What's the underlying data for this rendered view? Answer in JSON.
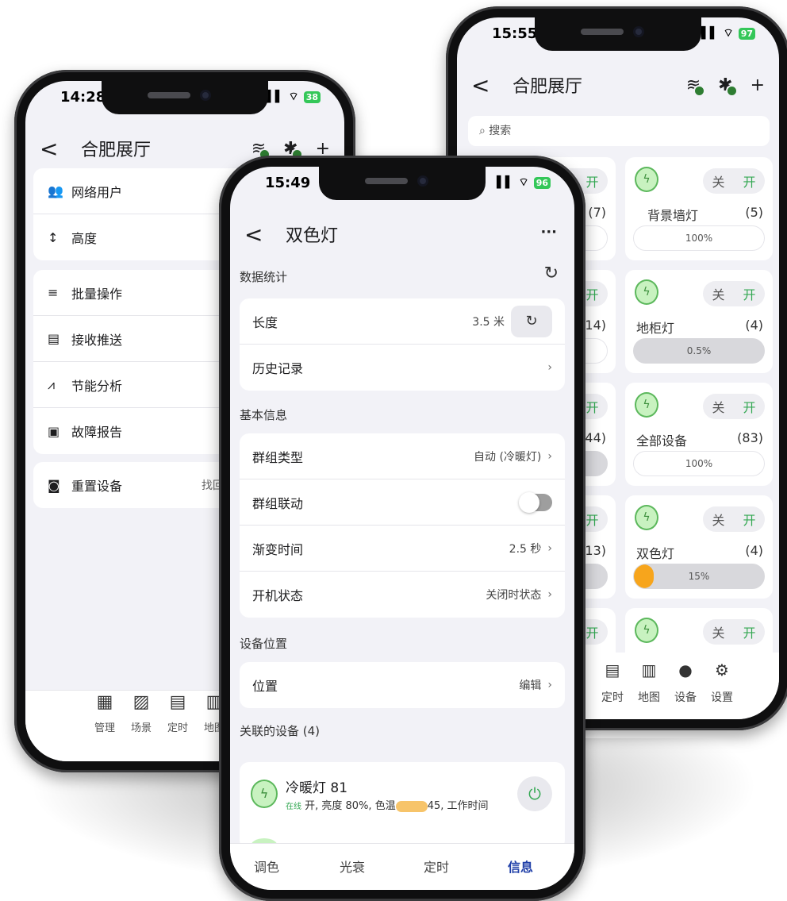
{
  "phoneA": {
    "status": {
      "time": "14:28",
      "battery": "38"
    },
    "nav": {
      "back": "<",
      "title": "合肥展厅",
      "add": "+"
    },
    "group1": [
      {
        "icon": "users-icon",
        "glyph": "👥",
        "label": "网络用户"
      },
      {
        "icon": "height-icon",
        "glyph": "↕",
        "label": "高度"
      }
    ],
    "group2": [
      {
        "icon": "batch-icon",
        "glyph": "≡",
        "label": "批量操作"
      },
      {
        "icon": "message-icon",
        "glyph": "▤",
        "label": "接收推送"
      },
      {
        "icon": "chart-icon",
        "glyph": "⩘",
        "label": "节能分析"
      },
      {
        "icon": "report-icon",
        "glyph": "▣",
        "label": "故障报告"
      }
    ],
    "group3": {
      "label": "重置设备",
      "value": "找回"
    },
    "tabs": [
      "管理",
      "场景",
      "定时",
      "地图"
    ]
  },
  "phoneC": {
    "status": {
      "time": "15:55",
      "battery": "97"
    },
    "nav": {
      "back": "<",
      "title": "合肥展厅",
      "add": "+"
    },
    "search_placeholder": "搜索",
    "toggle": {
      "off": "关",
      "on": "开"
    },
    "cards_left": [
      {
        "count": "(7)"
      },
      {
        "count": "(14)"
      },
      {
        "count": "44)"
      },
      {
        "count": "(13)"
      },
      {
        "count": ""
      }
    ],
    "cards_right": [
      {
        "name": "背景墙灯",
        "count": "(5)",
        "level": "100%",
        "bar": "white",
        "fill": 0
      },
      {
        "name": "地柜灯",
        "count": "(4)",
        "level": "0.5%",
        "bar": "grey",
        "fill": 0
      },
      {
        "name": "全部设备",
        "count": "(83)",
        "level": "100%",
        "bar": "white",
        "fill": 0
      },
      {
        "name": "双色灯",
        "count": "(4)",
        "level": "15%",
        "bar": "grey",
        "fill": 0.15
      },
      {
        "name": "",
        "count": "",
        "level": "",
        "bar": "none",
        "fill": 0
      }
    ],
    "tabs": [
      "定时",
      "地图",
      "设备",
      "设置"
    ]
  },
  "phoneB": {
    "status": {
      "time": "15:49",
      "battery": "96"
    },
    "nav": {
      "back": "<",
      "title": "双色灯",
      "more": "···"
    },
    "section_stats": "数据统计",
    "length": {
      "label": "长度",
      "value": "3.5 米"
    },
    "history": {
      "label": "历史记录"
    },
    "section_basic": "基本信息",
    "basic": [
      {
        "label": "群组类型",
        "value": "自动 (冷暖灯)"
      },
      {
        "label": "群组联动",
        "value": ""
      },
      {
        "label": "渐变时间",
        "value": "2.5 秒"
      },
      {
        "label": "开机状态",
        "value": "关闭时状态"
      }
    ],
    "section_location": "设备位置",
    "location": {
      "label": "位置",
      "value": "编辑"
    },
    "section_linked": "关联的设备 (4)",
    "device": {
      "name": "冷暖灯 81",
      "online": "在线",
      "status_a": "开, 亮度 80%, 色温",
      "status_b": "45, 工作时间"
    },
    "tabs": [
      "调色",
      "光衰",
      "定时",
      "信息"
    ]
  }
}
